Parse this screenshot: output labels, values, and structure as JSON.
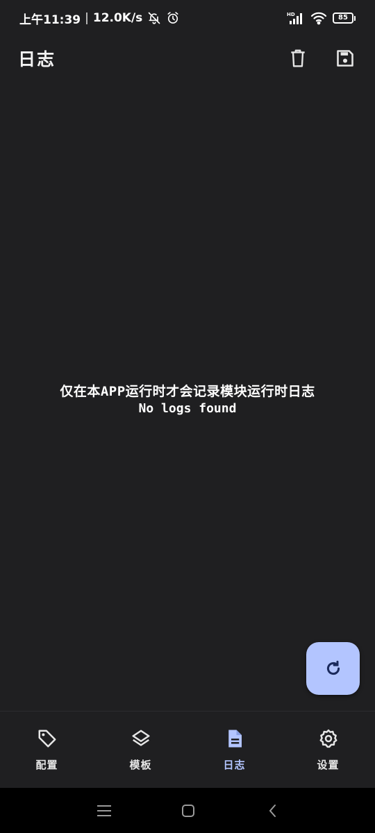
{
  "status_bar": {
    "time": "上午11:39",
    "separator": "|",
    "speed": "12.0K/s",
    "network_type": "HD",
    "battery_level": "85"
  },
  "app_bar": {
    "title": "日志",
    "actions": [
      {
        "icon": "trash-icon"
      },
      {
        "icon": "save-icon"
      }
    ]
  },
  "empty_state": {
    "message": "仅在本APP运行时才会记录模块运行时日志",
    "sub_message": "No logs found"
  },
  "fab": {
    "icon": "refresh-icon"
  },
  "bottom_nav": {
    "items": [
      {
        "label": "配置",
        "icon": "tag-icon",
        "active": false
      },
      {
        "label": "模板",
        "icon": "layers-icon",
        "active": false
      },
      {
        "label": "日志",
        "icon": "document-icon",
        "active": true
      },
      {
        "label": "设置",
        "icon": "gear-icon",
        "active": false
      }
    ]
  },
  "colors": {
    "background": "#1f1f21",
    "accent": "#b3c5ff",
    "text": "#ffffff",
    "system_nav": "#000000"
  }
}
